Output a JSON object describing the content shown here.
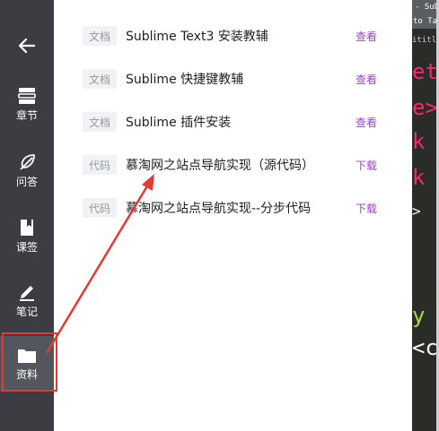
{
  "sidebar": {
    "back_icon": "arrow-left-icon",
    "items": [
      {
        "label": "章节",
        "icon": "chapter-icon"
      },
      {
        "label": "问答",
        "icon": "feather-icon"
      },
      {
        "label": "课签",
        "icon": "bookmark-icon"
      },
      {
        "label": "笔记",
        "icon": "pencil-icon"
      },
      {
        "label": "资料",
        "icon": "folder-icon"
      }
    ]
  },
  "resources": [
    {
      "tag": "文档",
      "title": "Sublime Text3 安装教辅",
      "action": "查看"
    },
    {
      "tag": "文档",
      "title": "Sublime 快捷键教辅",
      "action": "查看"
    },
    {
      "tag": "文档",
      "title": "Sublime 插件安装",
      "action": "查看"
    },
    {
      "tag": "代码",
      "title": "慕淘网之站点导航实现（源代码）",
      "action": "下载"
    },
    {
      "tag": "代码",
      "title": "慕淘网之站点导航实现--分步代码",
      "action": "下载"
    }
  ],
  "editor": {
    "title_fragment": "- Subli",
    "menu_fragment": "to  Tas",
    "tab_fragment": "ititled",
    "code": [
      "eta",
      "e>",
      "k r",
      "k r",
      ">",
      "y c",
      "<c"
    ]
  },
  "colors": {
    "sidebar_bg": "#3b3d42",
    "sidebar_active_bg": "#53565c",
    "action": "#9b3fd4",
    "annotation_red": "#e53935"
  }
}
